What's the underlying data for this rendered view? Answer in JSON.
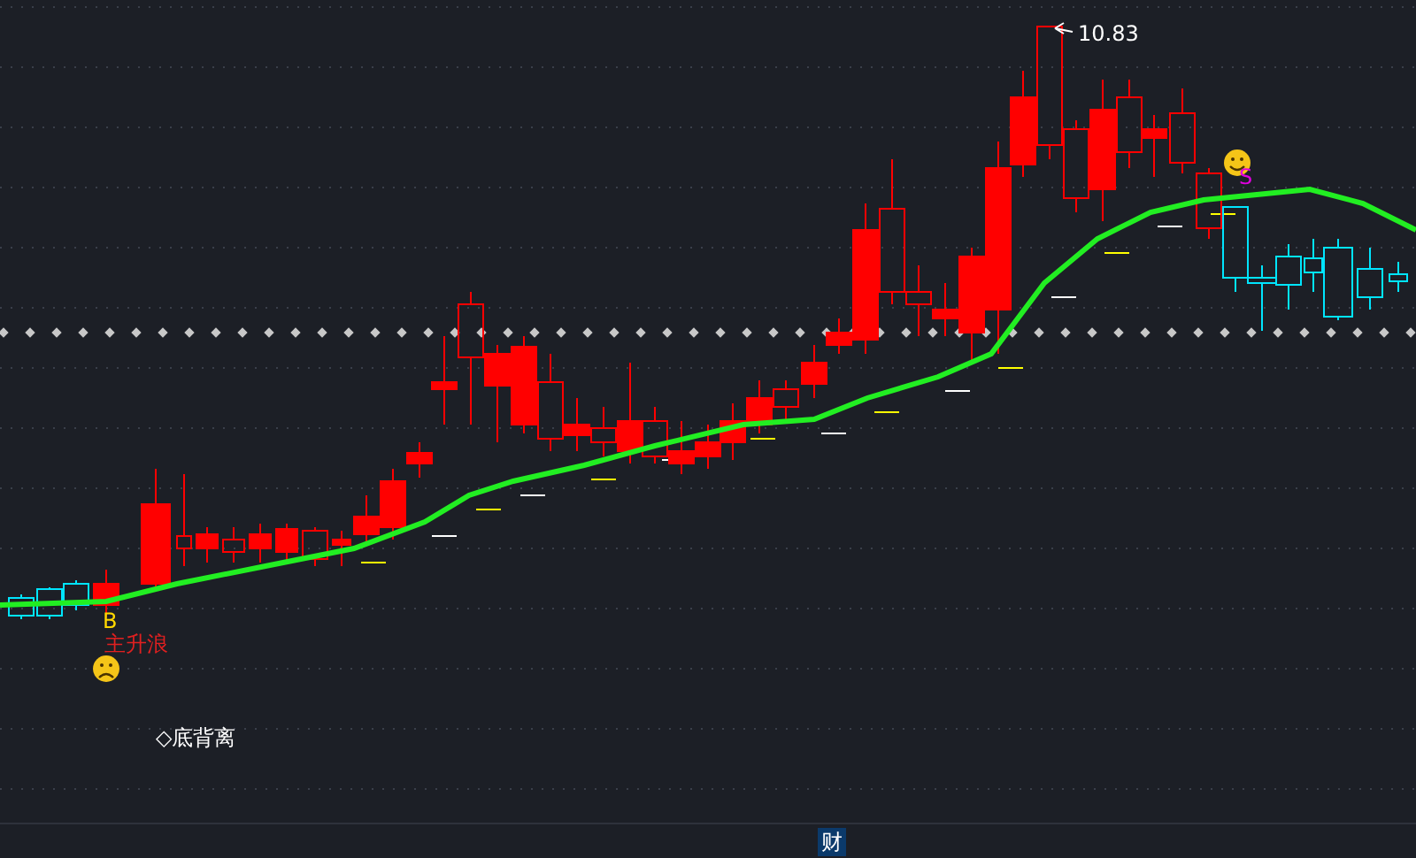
{
  "chart": {
    "high_label": "10.83",
    "signals": [
      {
        "kind": "buy",
        "text": "B"
      },
      {
        "kind": "sell",
        "text": "S"
      }
    ],
    "wave_label": "主升浪",
    "divergence_label": "◇底背离",
    "mood_markers": [
      {
        "kind": "sad"
      },
      {
        "kind": "happy"
      }
    ]
  },
  "footer": {
    "badge": "财"
  }
}
